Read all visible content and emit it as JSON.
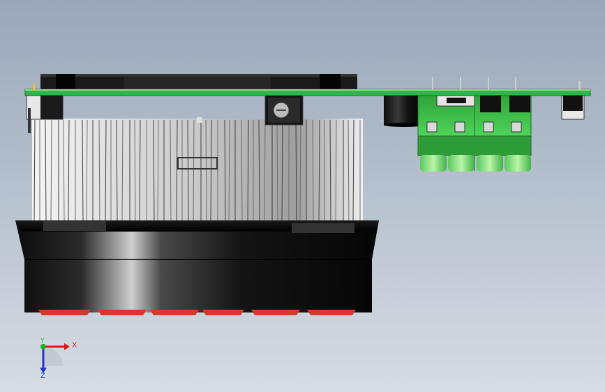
{
  "viewport": {
    "background_top": "#9aa7b9",
    "background_bottom": "#d7dce4"
  },
  "model": {
    "pcb_color": "#33b04a",
    "heatsink_color": "#e8e8e8",
    "fan_color": "#111111",
    "fan_blade_color": "#d23a2a",
    "connector_color": "#3ec24a"
  },
  "triad": {
    "x_label": "X",
    "y_label": "Y",
    "z_label": "Z",
    "x_color": "#d51a1a",
    "y_color": "#1fae2a",
    "z_color": "#2436c8"
  }
}
